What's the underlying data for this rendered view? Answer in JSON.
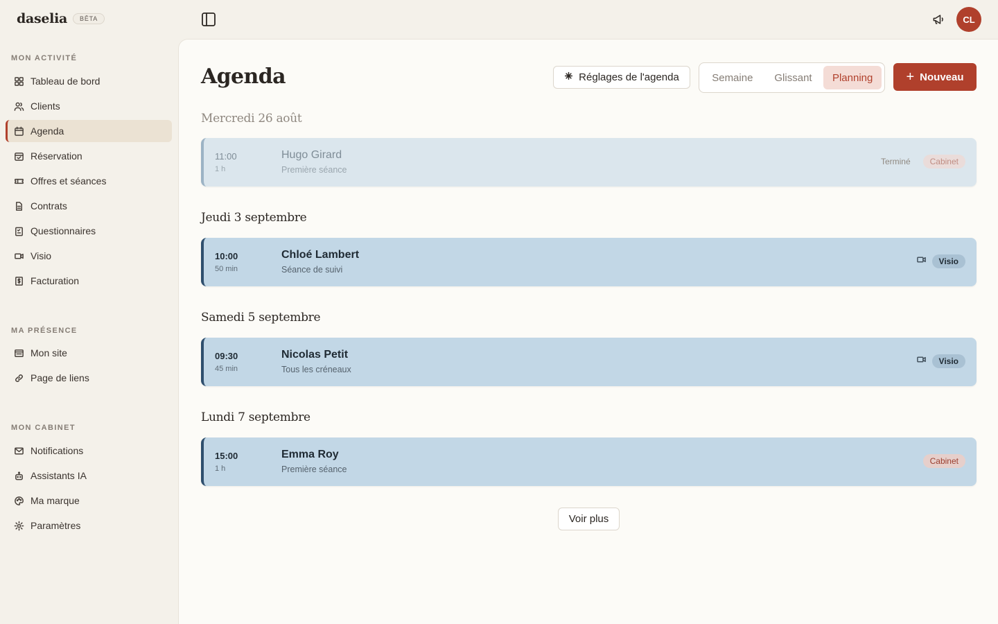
{
  "app": {
    "logo": "daselia",
    "beta": "BÊTA",
    "avatar_initials": "CL"
  },
  "colors": {
    "accent": "#b0402c",
    "event_bg": "#c2d7e6",
    "event_border": "#2f4f6e"
  },
  "sidebar": {
    "sections": [
      {
        "title": "MON ACTIVITÉ"
      },
      {
        "title": "MA PRÉSENCE"
      },
      {
        "title": "MON CABINET"
      }
    ],
    "items": [
      {
        "label": "Tableau de bord",
        "icon": "dashboard-icon"
      },
      {
        "label": "Clients",
        "icon": "users-icon"
      },
      {
        "label": "Agenda",
        "icon": "calendar-icon",
        "active": true
      },
      {
        "label": "Réservation",
        "icon": "calendar-check-icon"
      },
      {
        "label": "Offres et séances",
        "icon": "ticket-icon"
      },
      {
        "label": "Contrats",
        "icon": "document-icon"
      },
      {
        "label": "Questionnaires",
        "icon": "clipboard-icon"
      },
      {
        "label": "Visio",
        "icon": "video-icon"
      },
      {
        "label": "Facturation",
        "icon": "invoice-icon"
      },
      {
        "label": "Mon site",
        "icon": "website-icon"
      },
      {
        "label": "Page de liens",
        "icon": "link-icon"
      },
      {
        "label": "Notifications",
        "icon": "mail-icon"
      },
      {
        "label": "Assistants IA",
        "icon": "robot-icon"
      },
      {
        "label": "Ma marque",
        "icon": "palette-icon"
      },
      {
        "label": "Paramètres",
        "icon": "settings-icon"
      }
    ]
  },
  "main": {
    "title": "Agenda",
    "settings_button": "Réglages de l'agenda",
    "views": [
      "Semaine",
      "Glissant",
      "Planning"
    ],
    "active_view": "Planning",
    "new_button": "Nouveau",
    "more_button": "Voir plus",
    "days": [
      {
        "heading": "Mercredi 26 août",
        "events": [
          {
            "time": "11:00",
            "duration": "1 h",
            "name": "Hugo Girard",
            "type": "Première séance",
            "status": "Terminé",
            "location": "Cabinet"
          }
        ]
      },
      {
        "heading": "Jeudi 3 septembre",
        "events": [
          {
            "time": "10:00",
            "duration": "50 min",
            "name": "Chloé Lambert",
            "type": "Séance de suivi",
            "location": "Visio"
          }
        ]
      },
      {
        "heading": "Samedi 5 septembre",
        "events": [
          {
            "time": "09:30",
            "duration": "45 min",
            "name": "Nicolas Petit",
            "type": "Tous les créneaux",
            "location": "Visio"
          }
        ]
      },
      {
        "heading": "Lundi 7 septembre",
        "events": [
          {
            "time": "15:00",
            "duration": "1 h",
            "name": "Emma Roy",
            "type": "Première séance",
            "location": "Cabinet"
          }
        ]
      }
    ]
  }
}
